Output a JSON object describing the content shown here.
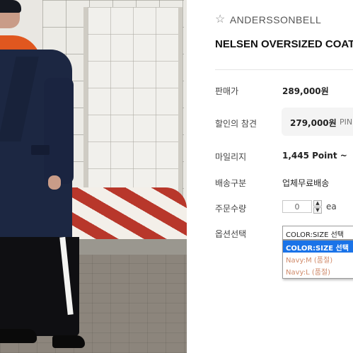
{
  "product": {
    "brand": "ANDERSSONBELL",
    "title": "NELSEN OVERSIZED COAT",
    "icons": {
      "favorite": "star-outline-icon"
    }
  },
  "info": {
    "price": {
      "label": "판매가",
      "value": "289,000원"
    },
    "coupon": {
      "label": "할인의 참견",
      "value": "279,000원",
      "extra": "PIN"
    },
    "mileage": {
      "label": "마일리지",
      "value": "1,445 Point ~"
    },
    "shipping": {
      "label": "배송구분",
      "value": "업체무료배송"
    },
    "quantity": {
      "label": "주문수량",
      "value": "0",
      "unit": "ea",
      "up": "▲",
      "down": "▼"
    },
    "option": {
      "label": "옵션선택",
      "selected": "COLOR:SIZE 선택",
      "options": [
        "COLOR:SIZE 선택",
        "Navy:M (품절)",
        "Navy:L (품절)"
      ]
    }
  },
  "colors": {
    "selected_option_bg": "#1a73e8",
    "soldout_text": "#d08a6a"
  }
}
